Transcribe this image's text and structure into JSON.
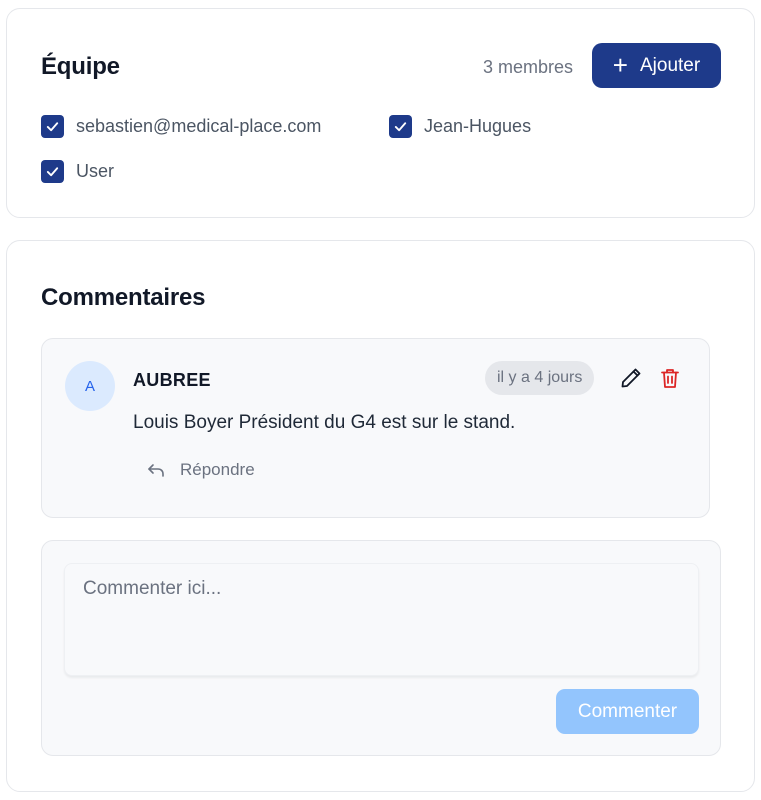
{
  "team": {
    "title": "Équipe",
    "members_count": "3 membres",
    "add_label": "Ajouter",
    "members": [
      {
        "label": "sebastien@medical-place.com",
        "checked": true
      },
      {
        "label": "Jean-Hugues",
        "checked": true
      },
      {
        "label": "User",
        "checked": true
      }
    ]
  },
  "comments": {
    "title": "Commentaires",
    "items": [
      {
        "avatar_initial": "A",
        "author": "AUBREE",
        "time": "il y a 4 jours",
        "text": "Louis Boyer Président du G4 est sur le stand.",
        "reply_label": "Répondre"
      }
    ],
    "composer": {
      "placeholder": "Commenter ici...",
      "value": "",
      "submit_label": "Commenter"
    }
  },
  "colors": {
    "primary": "#1e3a8a",
    "submit_disabled": "#93c5fd",
    "delete": "#dc2626",
    "avatar_bg": "#dbeafe"
  },
  "icons": {
    "add": "plus-icon",
    "checkbox": "check-icon",
    "edit": "pencil-icon",
    "delete": "trash-icon",
    "reply": "reply-icon"
  }
}
